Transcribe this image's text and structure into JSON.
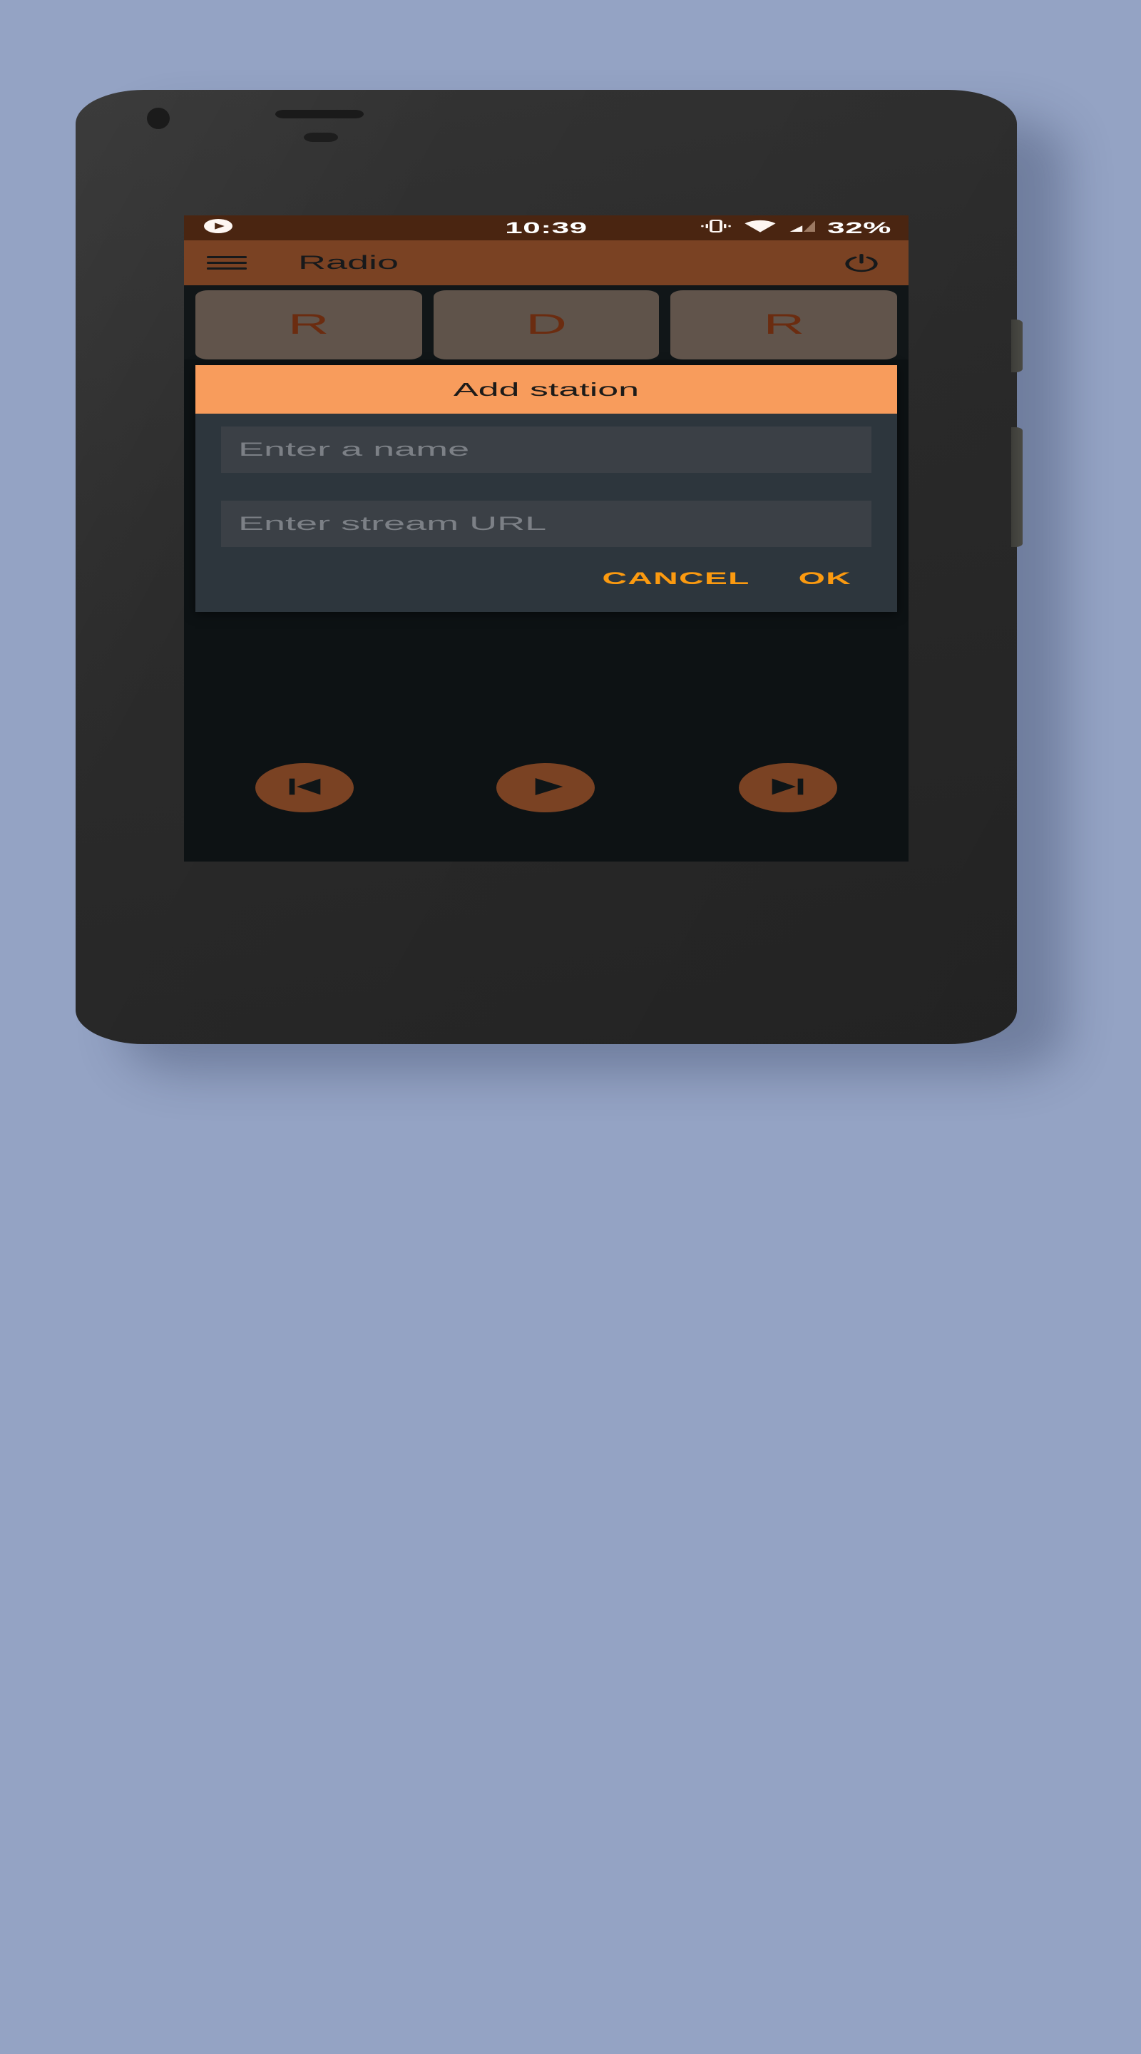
{
  "theme": {
    "page_background": "#94a3c4",
    "phone_body": "#2c2c2c",
    "screen_background": "#0d1214",
    "status_bar_bg": "#4a2511",
    "app_bar_bg": "#7a4223",
    "accent_orange": "#fb9a10",
    "dialog_header_bg": "#f89c5c",
    "dialog_body_bg": "#2d363d",
    "tile_bg": "#61544b",
    "tile_letter_color": "#6b2c10",
    "player_button_bg": "#7a4223"
  },
  "status_bar": {
    "notification_icon": "play-circle-icon",
    "clock": "10:39",
    "icons": [
      "vibrate-icon",
      "wifi-icon",
      "cellular-signal-icon"
    ],
    "battery_percent": "32%"
  },
  "app_bar": {
    "menu_icon": "hamburger-menu-icon",
    "title": "Radio",
    "power_icon": "power-icon"
  },
  "stations": [
    {
      "letter": "R"
    },
    {
      "letter": "D"
    },
    {
      "letter": "R"
    }
  ],
  "dialog": {
    "title": "Add station",
    "fields": [
      {
        "name": "station-name",
        "value": "",
        "placeholder": "Enter a name"
      },
      {
        "name": "stream-url",
        "value": "",
        "placeholder": "Enter stream URL"
      }
    ],
    "cancel_label": "CANCEL",
    "ok_label": "OK"
  },
  "player": {
    "previous_icon": "skip-previous-icon",
    "play_icon": "play-icon",
    "next_icon": "skip-next-icon"
  }
}
